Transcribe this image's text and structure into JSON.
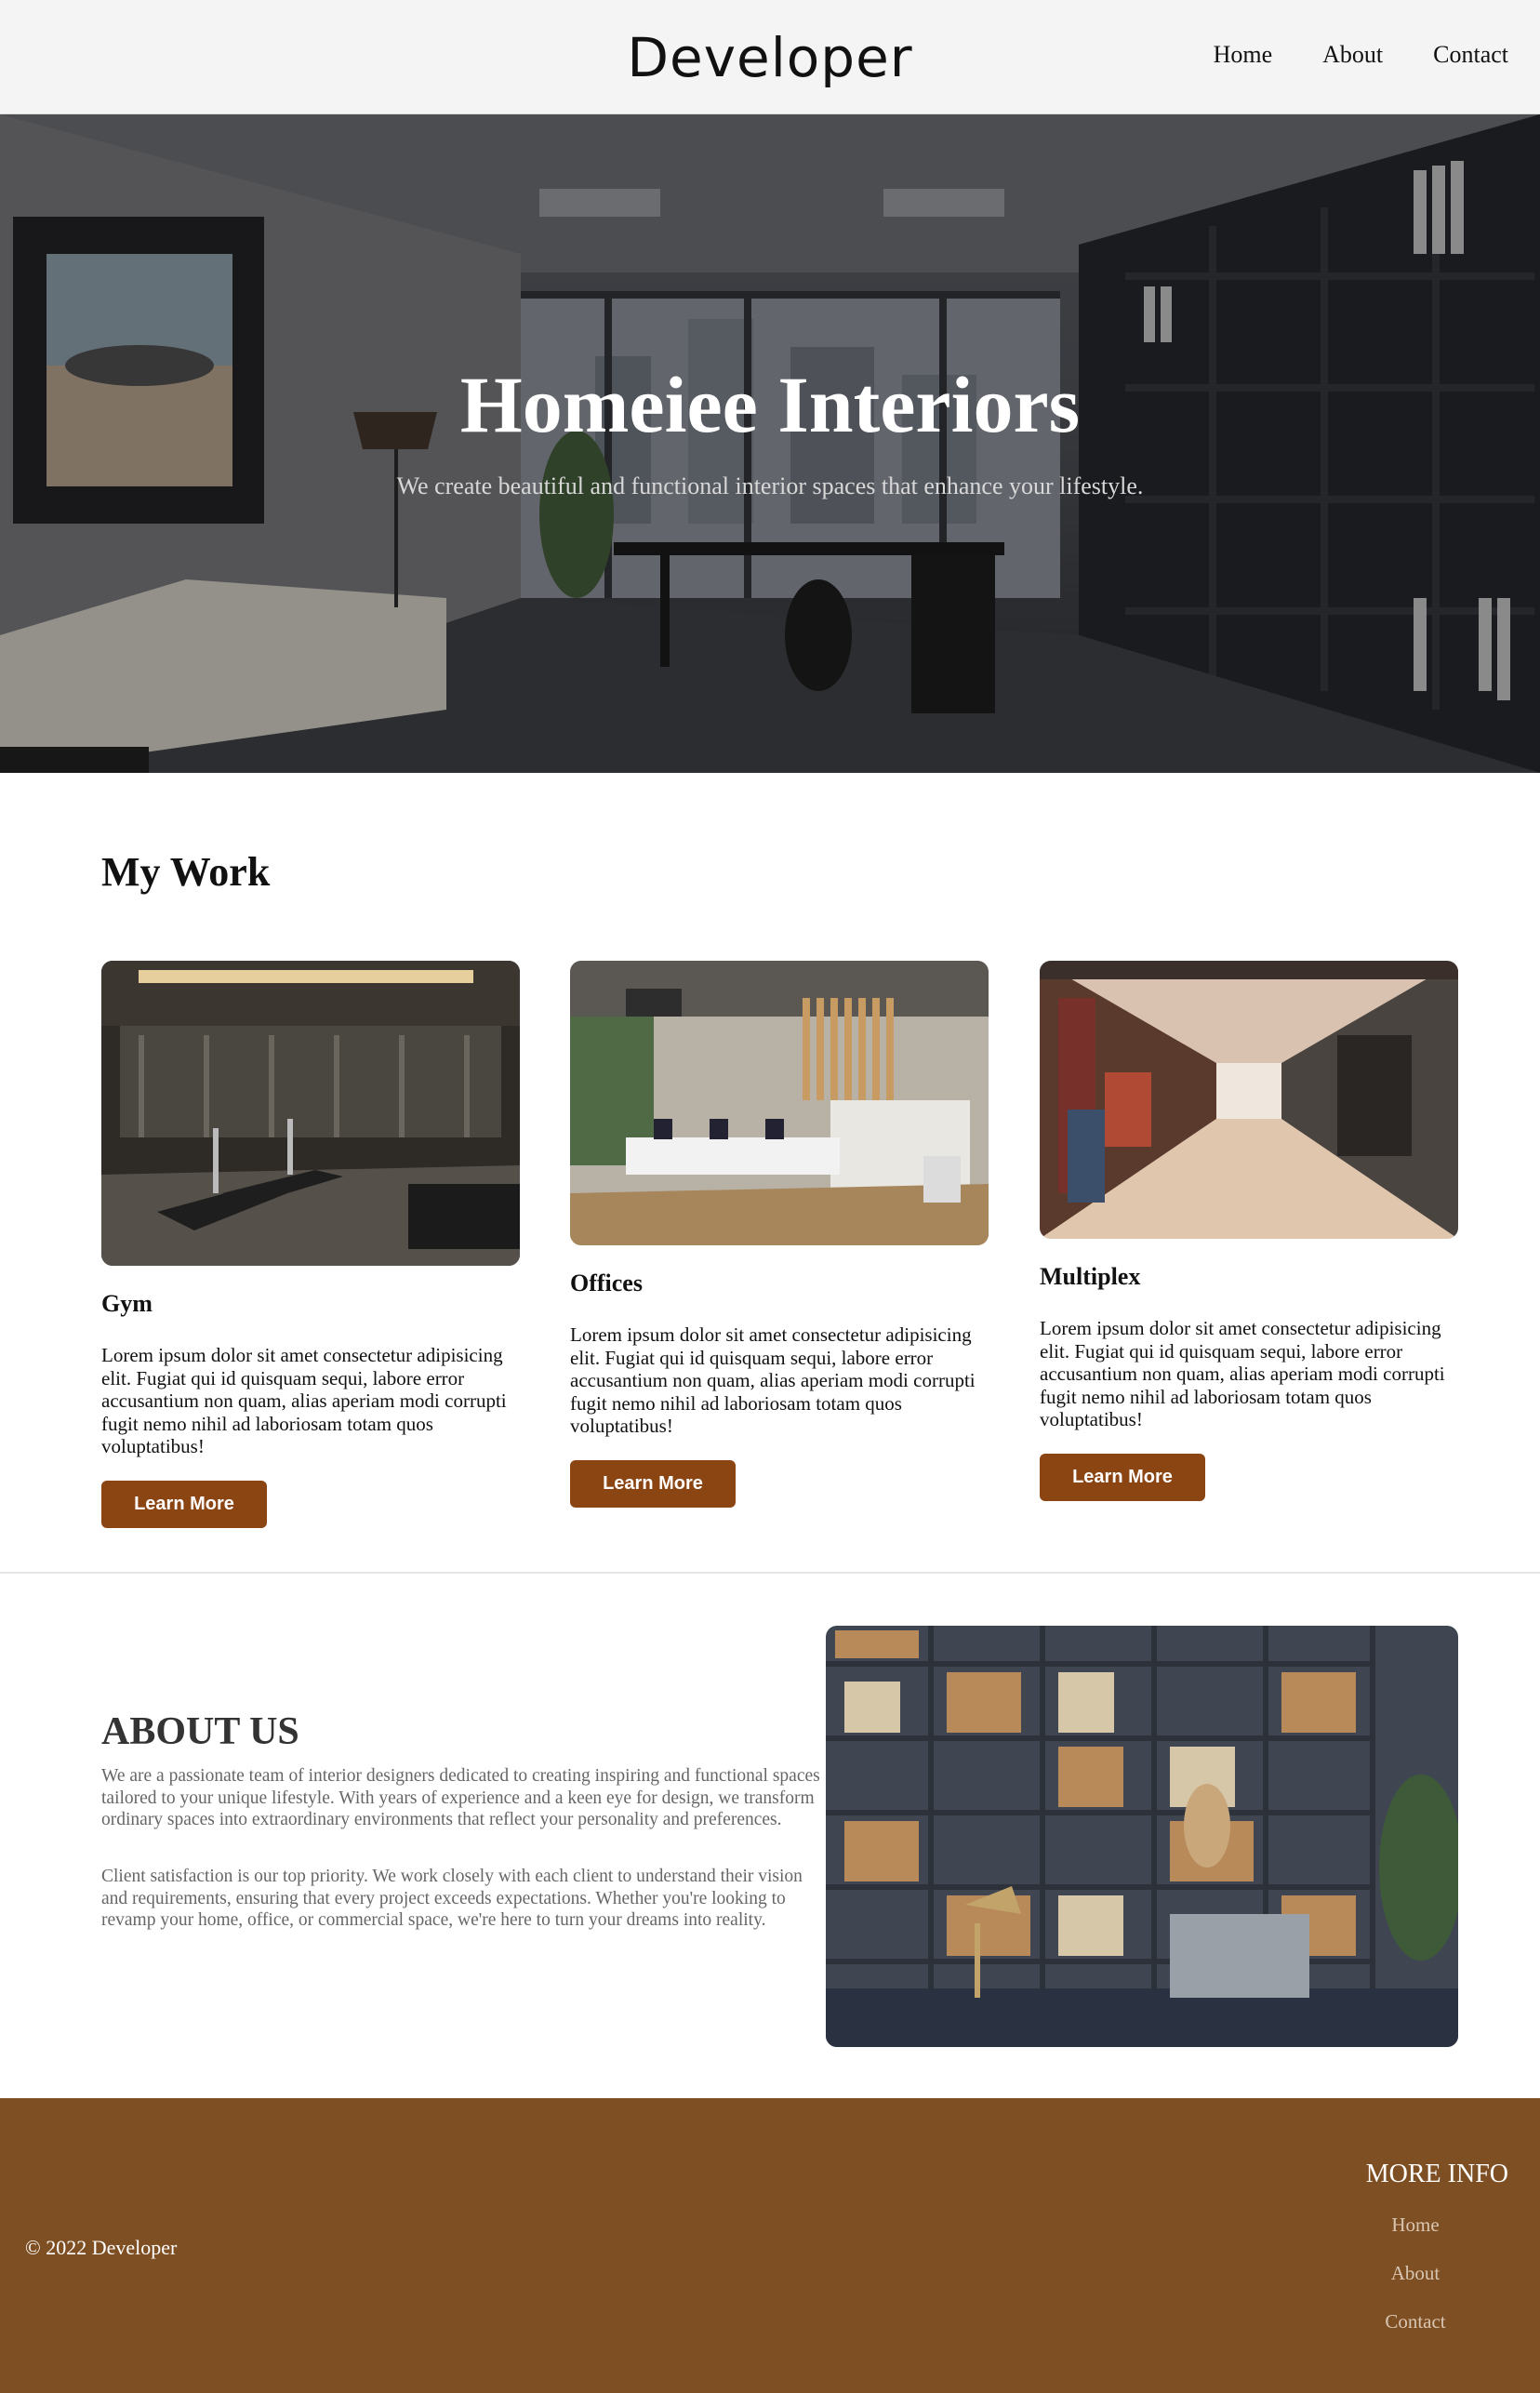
{
  "header": {
    "logo": "Developer",
    "nav": [
      "Home",
      "About",
      "Contact"
    ]
  },
  "hero": {
    "title": "Homeiee Interiors",
    "subtitle": "We create beautiful and functional interior spaces that enhance your lifestyle."
  },
  "work": {
    "title": "My Work",
    "cards": [
      {
        "title": "Gym",
        "text": "Lorem ipsum dolor sit amet consectetur adipisicing elit. Fugiat qui id quisquam sequi, labore error accusantium non quam, alias aperiam modi corrupti fugit nemo nihil ad laboriosam totam quos voluptatibus!",
        "button": "Learn More"
      },
      {
        "title": "Offices",
        "text": "Lorem ipsum dolor sit amet consectetur adipisicing elit. Fugiat qui id quisquam sequi, labore error accusantium non quam, alias aperiam modi corrupti fugit nemo nihil ad laboriosam totam quos voluptatibus!",
        "button": "Learn More"
      },
      {
        "title": "Multiplex",
        "text": "Lorem ipsum dolor sit amet consectetur adipisicing elit. Fugiat qui id quisquam sequi, labore error accusantium non quam, alias aperiam modi corrupti fugit nemo nihil ad laboriosam totam quos voluptatibus!",
        "button": "Learn More"
      }
    ]
  },
  "about": {
    "title": "ABOUT US",
    "p1": "We are a passionate team of interior designers dedicated to creating inspiring and functional spaces tailored to your unique lifestyle. With years of experience and a keen eye for design, we transform ordinary spaces into extraordinary environments that reflect your personality and preferences.",
    "p2": "Client satisfaction is our top priority. We work closely with each client to understand their vision and requirements, ensuring that every project exceeds expectations. Whether you're looking to revamp your home, office, or commercial space, we're here to turn your dreams into reality."
  },
  "footer": {
    "copyright": "© 2022 Developer",
    "more_info": "MORE INFO",
    "links": [
      "Home",
      "About",
      "Contact"
    ]
  },
  "colors": {
    "button": "#8b4513",
    "footer": "#7f4f24",
    "header": "#f4f4f4"
  }
}
